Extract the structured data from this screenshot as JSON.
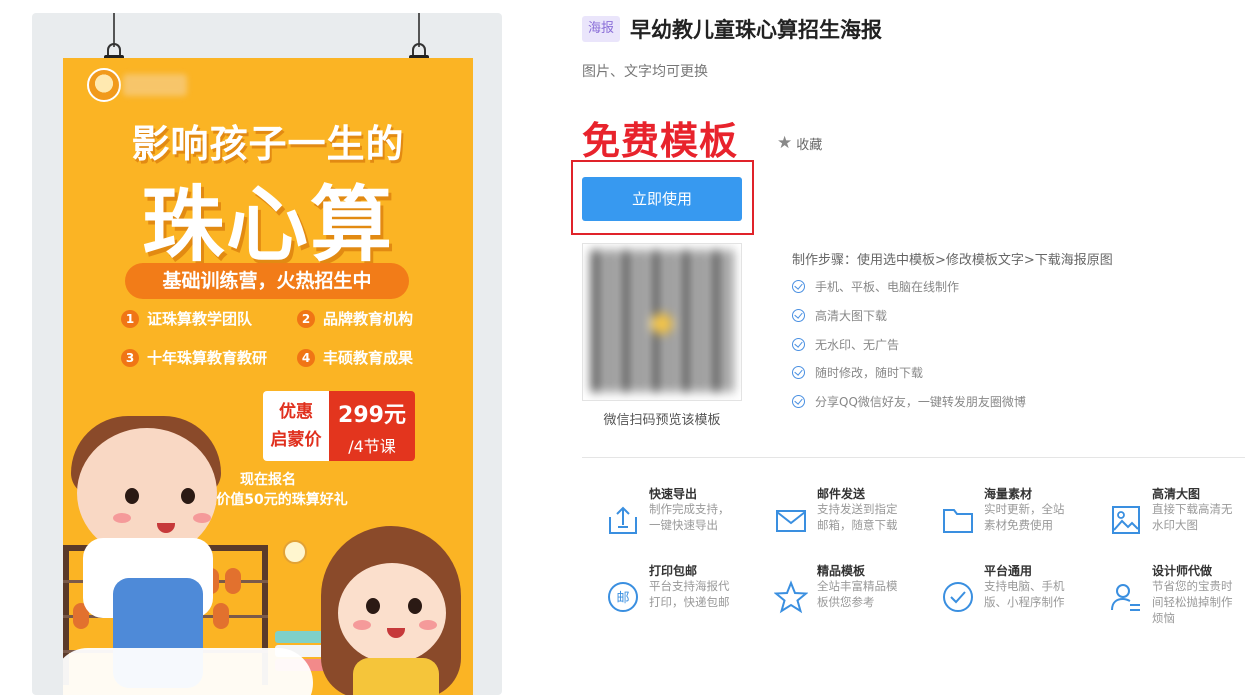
{
  "poster": {
    "headline_top": "影响孩子一生的",
    "headline_main": "珠心算",
    "pill": "基础训练营，火热招生中",
    "features": [
      {
        "num": "1",
        "text": "证珠算教学团队"
      },
      {
        "num": "2",
        "text": "品牌教育机构"
      },
      {
        "num": "3",
        "text": "十年珠算教育教研"
      },
      {
        "num": "4",
        "text": "丰硕教育成果"
      }
    ],
    "price_tag_line1": "优惠",
    "price_tag_line2": "启蒙价",
    "price": "299元",
    "price_unit": "/4节课",
    "sign_line1": "现在报名",
    "sign_line2": "赠送价值50元的珠算好礼"
  },
  "info": {
    "category_badge": "海报",
    "title": "早幼教儿童珠心算招生海报",
    "subtitle": "图片、文字均可更换",
    "free_label": "免费模板",
    "favorite_label": "收藏",
    "use_button": "立即使用",
    "qr_caption": "微信扫码预览该模板",
    "steps_heading": "制作步骤：使用选中模板>修改模板文字>下载海报原图",
    "checklist": [
      "手机、平板、电脑在线制作",
      "高清大图下载",
      "无水印、无广告",
      "随时修改，随时下载",
      "分享QQ微信好友，一键转发朋友圈微博"
    ]
  },
  "services": [
    {
      "icon": "upload-icon",
      "title": "快速导出",
      "desc": "制作完成支持，一键快速导出"
    },
    {
      "icon": "mail-icon",
      "title": "邮件发送",
      "desc": "支持发送到指定邮箱，随意下载"
    },
    {
      "icon": "folder-icon",
      "title": "海量素材",
      "desc": "实时更新，全站素材免费使用"
    },
    {
      "icon": "image-icon",
      "title": "高清大图",
      "desc": "直接下载高清无水印大图"
    },
    {
      "icon": "post-icon",
      "title": "打印包邮",
      "desc": "平台支持海报代打印，快递包邮"
    },
    {
      "icon": "star-icon",
      "title": "精品模板",
      "desc": "全站丰富精品模板供您参考"
    },
    {
      "icon": "check-circle-icon",
      "title": "平台通用",
      "desc": "支持电脑、手机版、小程序制作"
    },
    {
      "icon": "designer-icon",
      "title": "设计师代做",
      "desc": "节省您的宝贵时间轻松抛掉制作烦恼"
    }
  ],
  "icon_glyphs": {
    "post-icon": "邮"
  },
  "colors": {
    "poster_bg": "#fbb424",
    "accent_blue": "#3799f0",
    "free_red": "#e8232c",
    "badge_bg": "#eae5fb",
    "badge_text": "#8b6fd8"
  }
}
